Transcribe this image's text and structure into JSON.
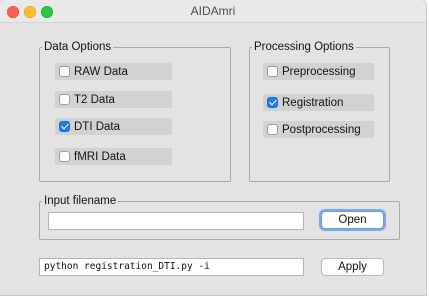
{
  "window": {
    "title": "AIDAmri"
  },
  "data_options": {
    "label": "Data Options",
    "items": [
      {
        "label": "RAW Data",
        "checked": false
      },
      {
        "label": "T2 Data",
        "checked": false
      },
      {
        "label": "DTI Data",
        "checked": true
      },
      {
        "label": "fMRI Data",
        "checked": false
      }
    ]
  },
  "processing_options": {
    "label": "Processing Options",
    "items": [
      {
        "label": "Preprocessing",
        "checked": false
      },
      {
        "label": "Registration",
        "checked": true
      },
      {
        "label": "Postprocessing",
        "checked": false
      }
    ]
  },
  "input": {
    "label": "Input filename",
    "value": "",
    "open_label": "Open"
  },
  "command": {
    "value": "python registration_DTI.py -i",
    "apply_label": "Apply"
  },
  "colors": {
    "accent": "#1f7cf6",
    "window_bg": "#e3e3e3"
  }
}
